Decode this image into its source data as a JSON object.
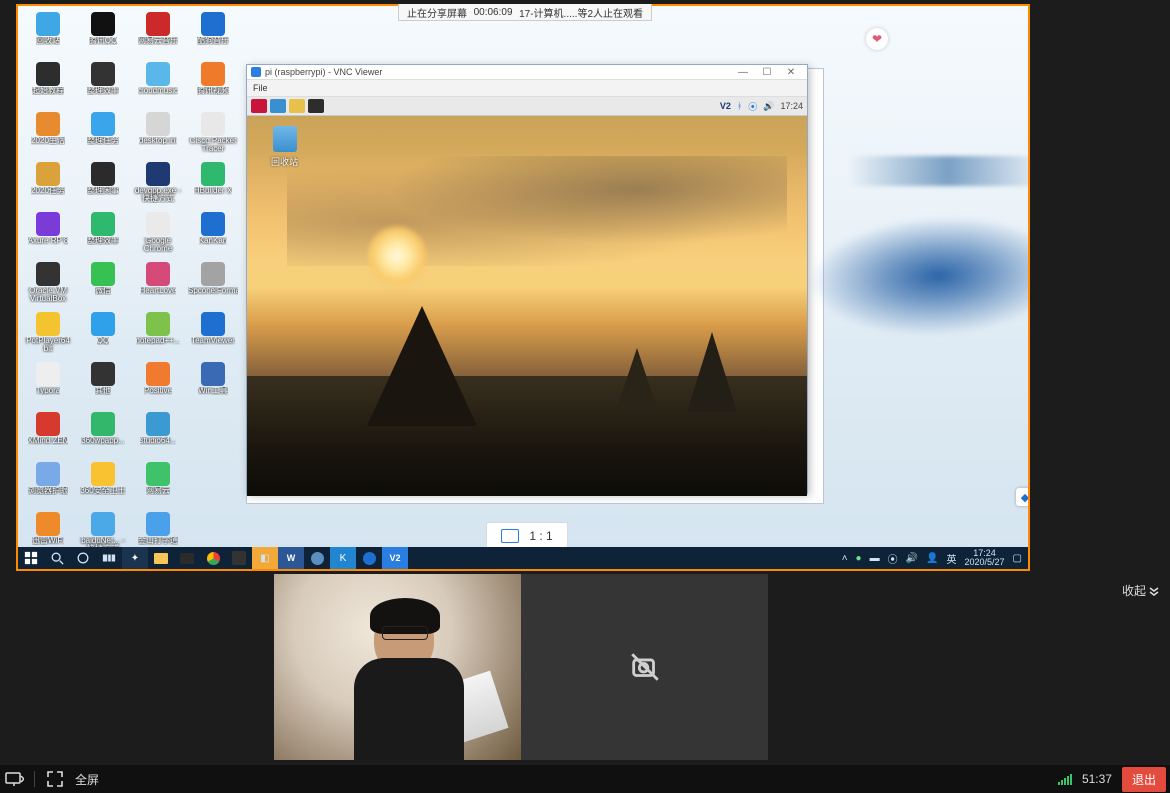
{
  "banner": {
    "stop_label": "止在分享屏幕",
    "elapsed": "00:06:09",
    "info": "17-计算机.....等2人止在观看"
  },
  "desktop_icons": [
    [
      {
        "label": "回收站",
        "color": "#3fa7e4"
      },
      {
        "label": "起始教程",
        "color": "#2d2d2d"
      },
      {
        "label": "2020生活",
        "color": "#e88b2e"
      },
      {
        "label": "2020任务",
        "color": "#d9a23a"
      },
      {
        "label": "Axure RP 8",
        "color": "#7a3bd8"
      },
      {
        "label": "Oracle VM VirtualBox",
        "color": "#333"
      },
      {
        "label": "PotPlayer64 bit",
        "color": "#f4c430"
      },
      {
        "label": "Typora",
        "color": "#eee"
      },
      {
        "label": "XMind ZEN",
        "color": "#d63a2e"
      },
      {
        "label": "浏览器护眼",
        "color": "#7aa9e8"
      },
      {
        "label": "迅雷WiFi",
        "color": "#ef8a2a"
      }
    ],
    [
      {
        "label": "腾讯QQ",
        "color": "#111"
      },
      {
        "label": "整理效率",
        "color": "#333"
      },
      {
        "label": "整理任务",
        "color": "#3aa5ea"
      },
      {
        "label": "整理闲事",
        "color": "#2b2b2b"
      },
      {
        "label": "整理效率",
        "color": "#2fb96e"
      },
      {
        "label": "微信",
        "color": "#36c152"
      },
      {
        "label": "QQ",
        "color": "#2fa0ea"
      },
      {
        "label": "其他",
        "color": "#333"
      },
      {
        "label": "360wpapp...",
        "color": "#33b76a"
      },
      {
        "label": "360安全卫士",
        "color": "#f8c231"
      },
      {
        "label": "baiduNet... - 快捷方式",
        "color": "#4ca9e8"
      }
    ],
    [
      {
        "label": "网易云音乐",
        "color": "#cc2a2a"
      },
      {
        "label": "cloudmusic",
        "color": "#5ab7ea"
      },
      {
        "label": "desktop.ini",
        "color": "#d6d6d6"
      },
      {
        "label": "devqpp.exe - 快捷方式",
        "color": "#1f3a73"
      },
      {
        "label": "Google Chrome",
        "color": "#eaeaea"
      },
      {
        "label": "HeartLove",
        "color": "#d64a7a"
      },
      {
        "label": "notepad++...",
        "color": "#7dc24a"
      },
      {
        "label": "Positive",
        "color": "#f07a2e"
      },
      {
        "label": "studio64...",
        "color": "#3a9ad1"
      },
      {
        "label": "网易云",
        "color": "#3ec26a"
      },
      {
        "label": "金山打字通",
        "color": "#4aa0ea"
      }
    ],
    [
      {
        "label": "酷狗音乐",
        "color": "#1f6fd1"
      },
      {
        "label": "腾讯视频",
        "color": "#ef7a2a"
      },
      {
        "label": "Cisco Packet Tracer",
        "color": "#e8e8e8"
      },
      {
        "label": "HBuilder X",
        "color": "#2fb96e"
      },
      {
        "label": "KanKan",
        "color": "#1f6fd1"
      },
      {
        "label": "SpconelFormatter",
        "color": "#a3a3a3"
      },
      {
        "label": "TeamViewer",
        "color": "#1f6fd1"
      },
      {
        "label": "Win工具",
        "color": "#3a6ab4"
      }
    ]
  ],
  "vnc": {
    "title": "pi (raspberrypi) - VNC Viewer",
    "menu_file": "File",
    "clock": "17:24",
    "trash_label": "回收站"
  },
  "ratio": {
    "label": "1 : 1"
  },
  "windows_taskbar": {
    "ime": "英",
    "time": "17:24",
    "date": "2020/5/27"
  },
  "participant_area": {
    "collapse_label": "收起"
  },
  "bottombar": {
    "fullscreen_label": "全屏",
    "timer": "51:37",
    "exit_label": "退出"
  }
}
